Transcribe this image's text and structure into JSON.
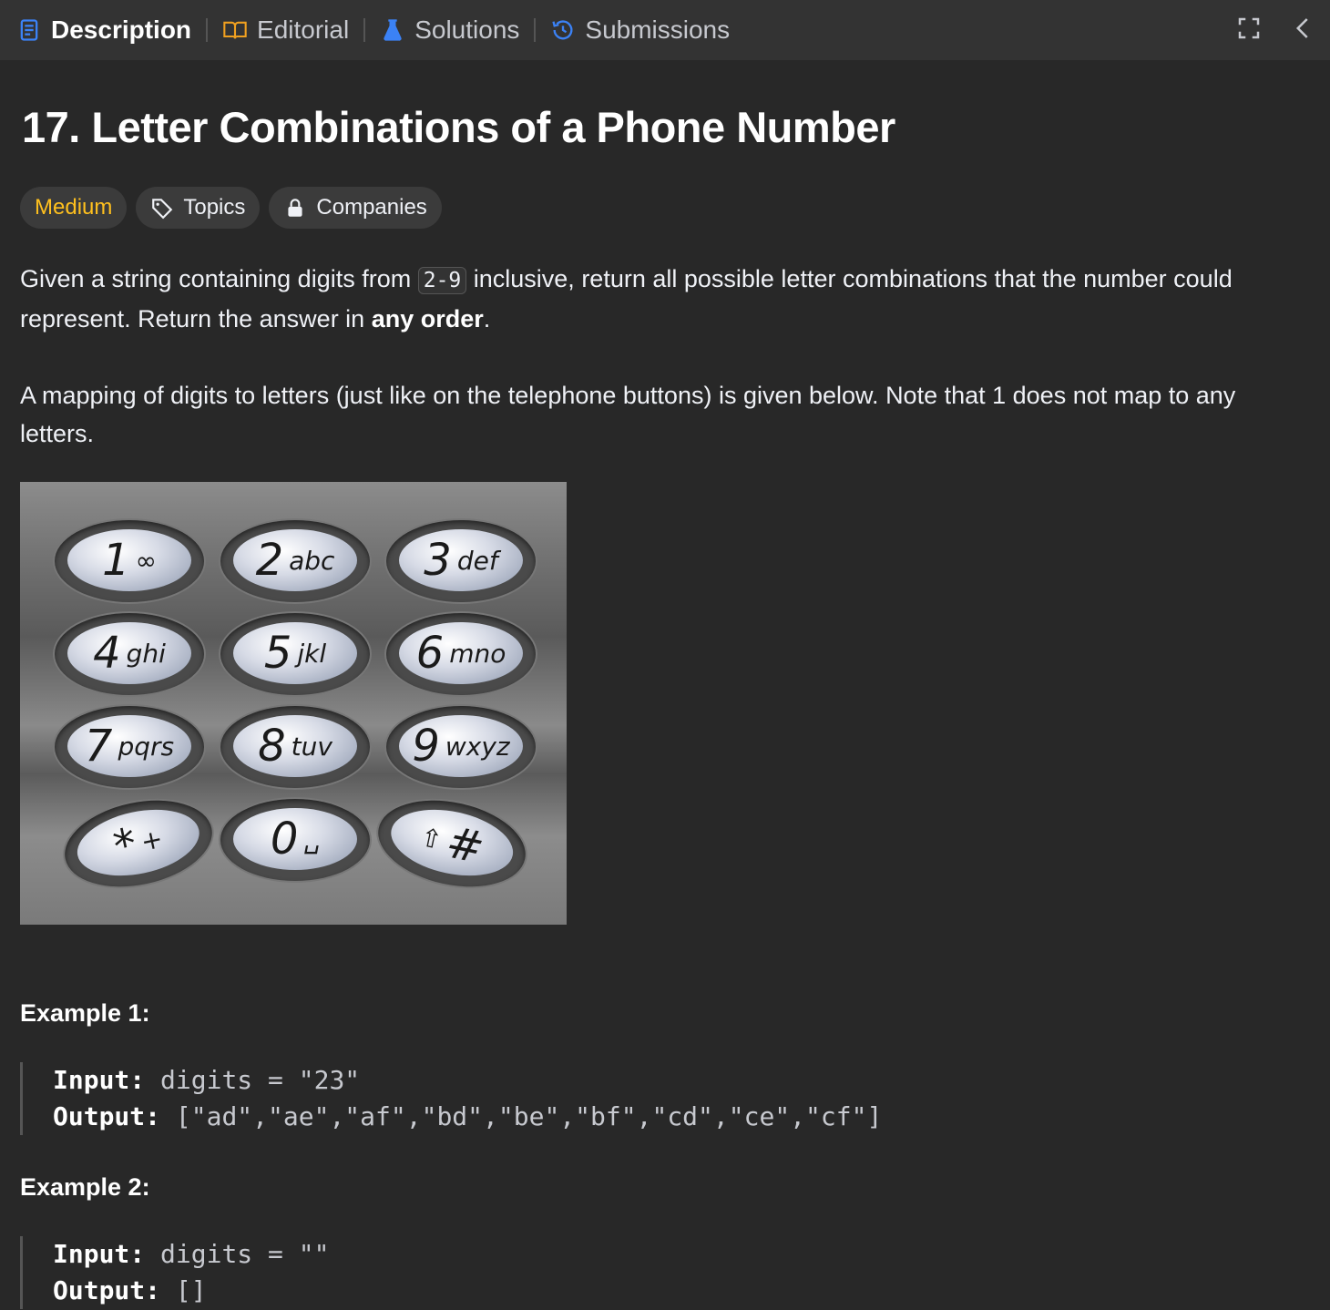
{
  "tabs": [
    {
      "label": "Description",
      "icon": "description-icon",
      "active": true
    },
    {
      "label": "Editorial",
      "icon": "book-icon"
    },
    {
      "label": "Solutions",
      "icon": "flask-icon"
    },
    {
      "label": "Submissions",
      "icon": "history-icon"
    }
  ],
  "problem": {
    "title": "17. Letter Combinations of a Phone Number",
    "difficulty": "Medium",
    "topics_label": "Topics",
    "companies_label": "Companies",
    "para1_a": "Given a string containing digits from ",
    "para1_code": "2-9",
    "para1_b": " inclusive, return all possible letter combinations that the number could represent. Return the answer in ",
    "para1_bold": "any order",
    "para1_c": ".",
    "para2": "A mapping of digits to letters (just like on the telephone buttons) is given below. Note that 1 does not map to any letters."
  },
  "keypad": [
    {
      "digit": "1",
      "letters": "∞"
    },
    {
      "digit": "2",
      "letters": "abc"
    },
    {
      "digit": "3",
      "letters": "def"
    },
    {
      "digit": "4",
      "letters": "ghi"
    },
    {
      "digit": "5",
      "letters": "jkl"
    },
    {
      "digit": "6",
      "letters": "mno"
    },
    {
      "digit": "7",
      "letters": "pqrs"
    },
    {
      "digit": "8",
      "letters": "tuv"
    },
    {
      "digit": "9",
      "letters": "wxyz"
    },
    {
      "digit": "*",
      "letters": "+"
    },
    {
      "digit": "0",
      "letters": "␣"
    },
    {
      "digit": "⇧",
      "letters": "#"
    }
  ],
  "examples": [
    {
      "title": "Example 1:",
      "input_label": "Input:",
      "input_value": "digits = \"23\"",
      "output_label": "Output:",
      "output_value": "[\"ad\",\"ae\",\"af\",\"bd\",\"be\",\"bf\",\"cd\",\"ce\",\"cf\"]"
    },
    {
      "title": "Example 2:",
      "input_label": "Input:",
      "input_value": "digits = \"\"",
      "output_label": "Output:",
      "output_value": "[]"
    }
  ]
}
